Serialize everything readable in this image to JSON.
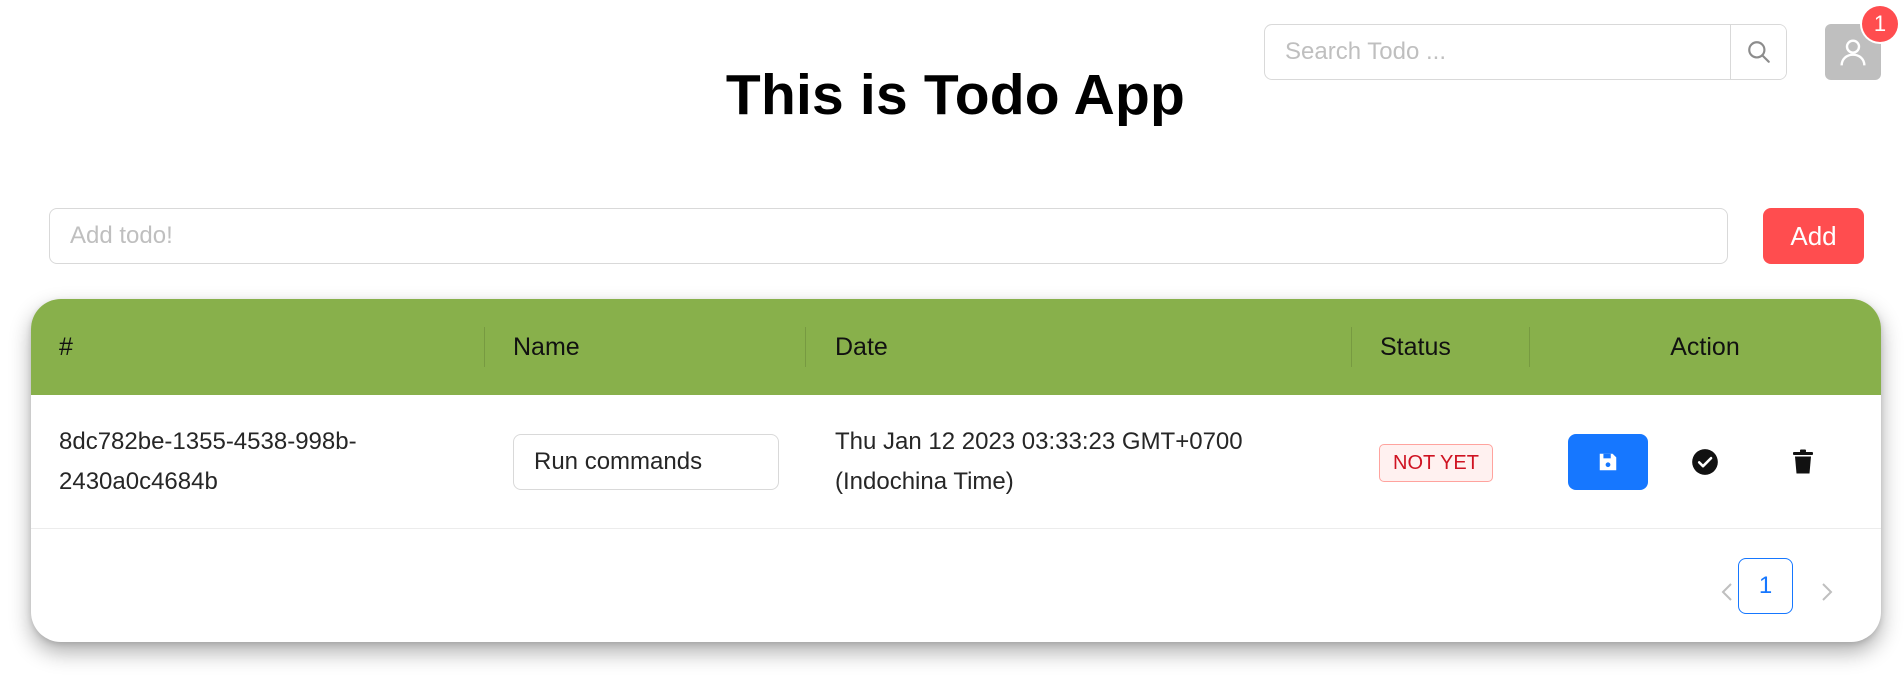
{
  "app": {
    "title": "This is Todo App"
  },
  "search": {
    "placeholder": "Search Todo ...",
    "icon": "search-icon"
  },
  "user": {
    "icon": "user-icon",
    "notification_count": "1"
  },
  "add_form": {
    "placeholder": "Add todo!",
    "button_label": "Add"
  },
  "table": {
    "columns": [
      "#",
      "Name",
      "Date",
      "Status",
      "Action"
    ],
    "rows": [
      {
        "id_line1": "8dc782be-1355-4538-998b-",
        "id_line2": "2430a0c4684b",
        "name": "Run commands",
        "date_line1": "Thu Jan 12 2023 03:33:23 GMT+0700",
        "date_line2": "(Indochina Time)",
        "status": "NOT YET",
        "actions": [
          "save-icon",
          "check-circle-icon",
          "delete-icon"
        ]
      }
    ]
  },
  "pagination": {
    "current_page": "1"
  },
  "colors": {
    "header": "#88b04b",
    "primary": "#1677ff",
    "danger": "#ff4d4f",
    "status_text": "#cf1322"
  }
}
